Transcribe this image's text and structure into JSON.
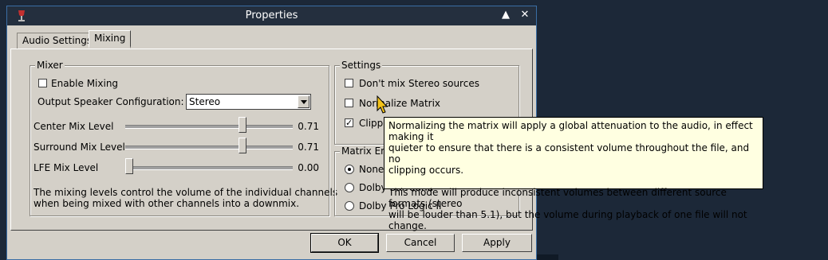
{
  "window": {
    "title": "Properties"
  },
  "tabs": [
    {
      "label": "Audio Settings"
    },
    {
      "label": "Mixing"
    }
  ],
  "mixer": {
    "legend": "Mixer",
    "enable_mixing": {
      "label": "Enable Mixing",
      "checked": false
    },
    "output_config": {
      "label": "Output Speaker Configuration:",
      "value": "Stereo"
    },
    "sliders": [
      {
        "label": "Center Mix Level",
        "value": "0.71",
        "fraction": 0.71
      },
      {
        "label": "Surround Mix Level",
        "value": "0.71",
        "fraction": 0.71
      },
      {
        "label": "LFE Mix Level",
        "value": "0.00",
        "fraction": 0.0
      }
    ],
    "description_line1": "The mixing levels control the volume of the individual channels",
    "description_line2": "when being mixed with other channels into a downmix."
  },
  "settings": {
    "legend": "Settings",
    "dont_mix_stereo": {
      "label": "Don't mix Stereo sources",
      "checked": false
    },
    "normalize_matrix": {
      "label": "Normalize Matrix",
      "checked": false
    },
    "clipping": {
      "label": "Clipping",
      "checked": true
    }
  },
  "matrix_encoding": {
    "legend": "Matrix Encoding",
    "options": [
      {
        "label": "None",
        "selected": true
      },
      {
        "label": "Dolby Surround",
        "selected": false
      },
      {
        "label": "Dolby Pro Logic II",
        "selected": false
      }
    ]
  },
  "buttons": {
    "ok": "OK",
    "cancel": "Cancel",
    "apply": "Apply"
  },
  "tooltip": {
    "line1": "Normalizing the matrix will apply a global attenuation to the audio, in effect making it",
    "line2": "quieter to ensure that there is a consistent volume throughout the file, and no",
    "line3": "clipping occurs.",
    "line4": "This mode will produce inconsistent volumes between different source formats (stereo",
    "line5": "will be louder than 5.1), but the volume during playback of one file will not change."
  },
  "icons": {
    "app": "app-glass-icon",
    "maximize": "maximize-icon",
    "close": "close-icon",
    "cursor": "mouse-pointer-icon"
  }
}
